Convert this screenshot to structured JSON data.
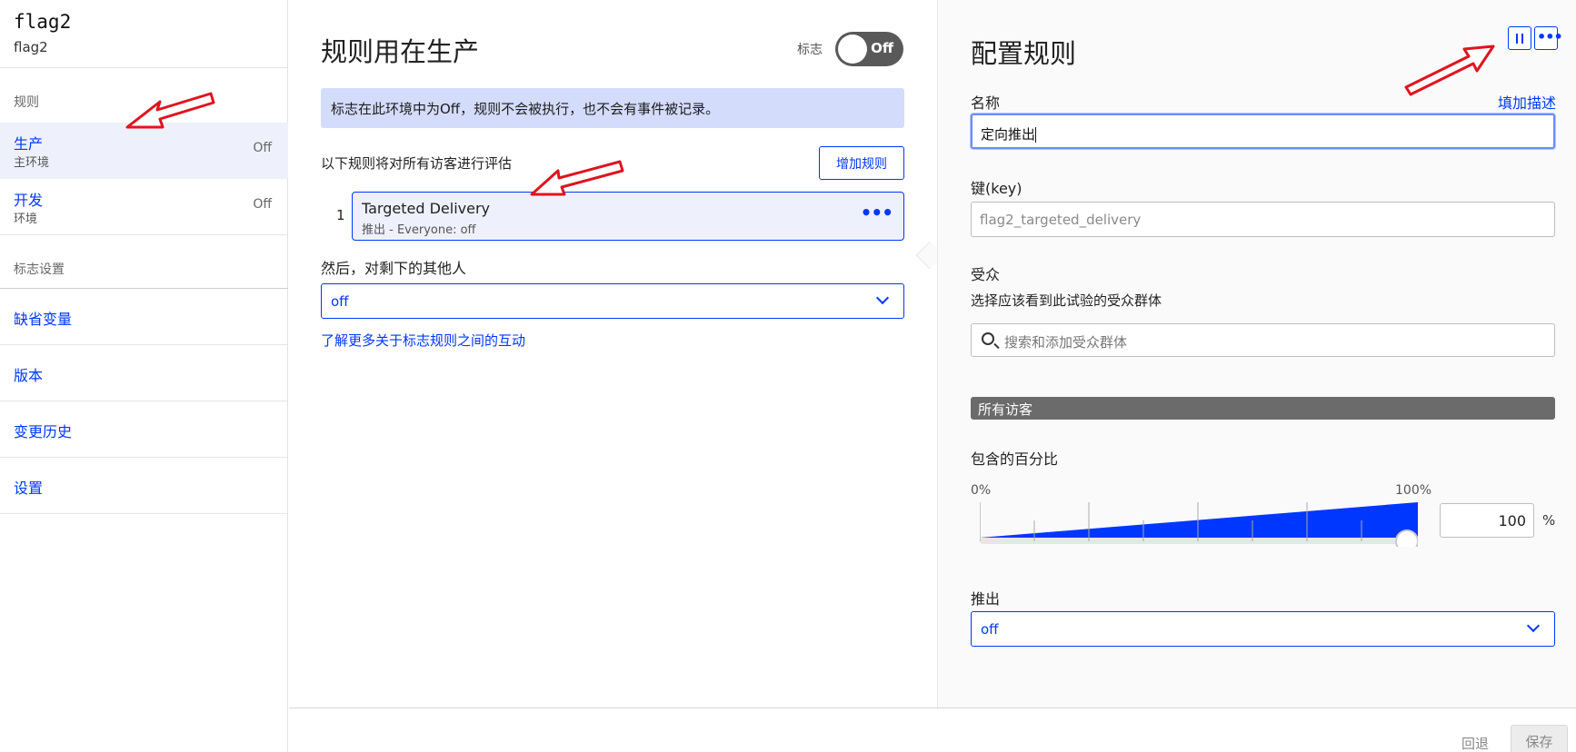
{
  "sidebar": {
    "flag_key": "flag2",
    "flag_name": "flag2",
    "rules_section": "规则",
    "environments": [
      {
        "name": "生产",
        "desc": "主环境",
        "status": "Off"
      },
      {
        "name": "开发",
        "desc": "环境",
        "status": "Off"
      }
    ],
    "settings_section": "标志设置",
    "links": [
      "缺省变量",
      "版本",
      "变更历史",
      "设置"
    ]
  },
  "middle": {
    "title": "规则用在生产",
    "toggle_label": "标志",
    "toggle_state": "Off",
    "notice": "标志在此环境中为Off，规则不会被执行，也不会有事件被记录。",
    "eval_label": "以下规则将对所有访客进行评估",
    "add_rule_button": "增加规则",
    "rules": [
      {
        "index": "1",
        "name": "Targeted Delivery",
        "desc": "推出 - Everyone: off"
      }
    ],
    "rest_label": "然后，对剩下的其他人",
    "rest_value": "off",
    "learn_link": "了解更多关于标志规则之间的互动"
  },
  "right": {
    "title": "配置规则",
    "name_label": "名称",
    "add_description": "填加描述",
    "name_value": "定向推出",
    "key_label": "键(key)",
    "key_placeholder": "flag2_targeted_delivery",
    "audience_label": "受众",
    "audience_sub": "选择应该看到此试验的受众群体",
    "audience_search_placeholder": "搜索和添加受众群体",
    "audience_chip": "所有访客",
    "percent_label": "包含的百分比",
    "percent_min": "0%",
    "percent_max": "100%",
    "percent_value": "100",
    "percent_sign": "%",
    "percent_fill": 1.0,
    "rollout_label": "推出",
    "rollout_value": "off"
  },
  "footer": {
    "undo": "回退",
    "save": "保存"
  },
  "colors": {
    "accent": "#0037ff",
    "notice_bg": "#d4dcfb",
    "active_bg": "#eef1fb",
    "toggle_off": "#595959",
    "chip_bg": "#6b6b6b",
    "annotation_arrow": "#e0141e"
  },
  "icons": {
    "pause": "pause-icon",
    "more": "more-dots-icon",
    "search": "search-icon",
    "chevron": "chevron-down-icon"
  }
}
